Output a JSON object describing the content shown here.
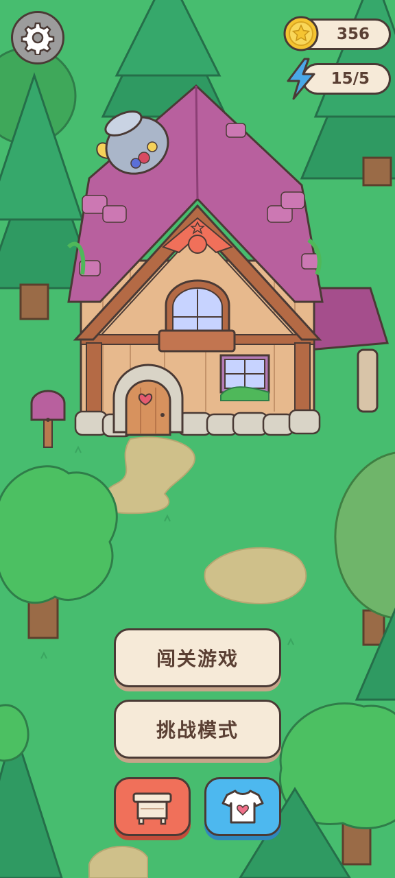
{
  "hud": {
    "coins": "356",
    "energy": "15/5"
  },
  "icons": {
    "settings": "gear-icon",
    "coin": "coin-star-icon",
    "energy": "lightning-icon",
    "furniture": "cabinet-icon",
    "wardrobe": "tshirt-heart-icon"
  },
  "menu": {
    "level_mode_label": "闯关游戏",
    "challenge_mode_label": "挑战模式"
  },
  "colors": {
    "grass": "#47bd6f",
    "button_cream": "#f6ead8",
    "furniture_button": "#f0705a",
    "wardrobe_button": "#4db8ef",
    "roof_purple": "#b8609e",
    "coin_gold": "#f5c431",
    "energy_blue": "#4aa8e8"
  }
}
